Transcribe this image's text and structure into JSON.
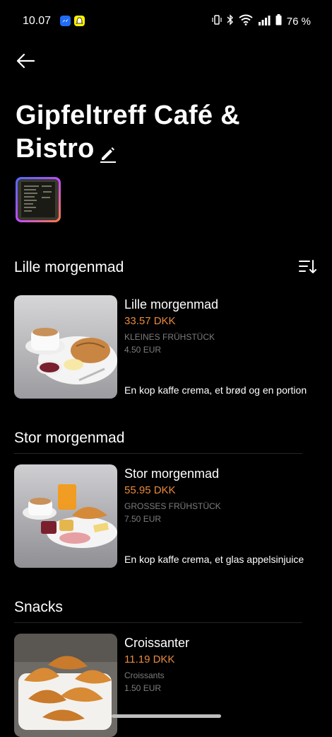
{
  "status_bar": {
    "time": "10.07",
    "battery": "76 %"
  },
  "page": {
    "title": "Gipfeltreff Café & Bistro"
  },
  "sections": [
    {
      "title": "Lille morgenmad",
      "items": [
        {
          "name": "Lille morgenmad",
          "price": "33.57 DKK",
          "subtitle": "KLEINES FRÜHSTÜCK",
          "eur_price": "4.50 EUR",
          "description": "En kop kaffe crema, et brød og en portion"
        }
      ]
    },
    {
      "title": "Stor morgenmad",
      "items": [
        {
          "name": "Stor morgenmad",
          "price": "55.95 DKK",
          "subtitle": "GROSSES FRÜHSTÜCK",
          "eur_price": "7.50 EUR",
          "description": "En kop kaffe crema, et glas appelsinjuice"
        }
      ]
    },
    {
      "title": "Snacks",
      "items": [
        {
          "name": "Croissanter",
          "price": "11.19 DKK",
          "subtitle": "Croissants",
          "eur_price": "1.50 EUR"
        }
      ]
    }
  ],
  "colors": {
    "background": "#000000",
    "price": "#e98a3c",
    "muted": "#7d7d7d"
  }
}
